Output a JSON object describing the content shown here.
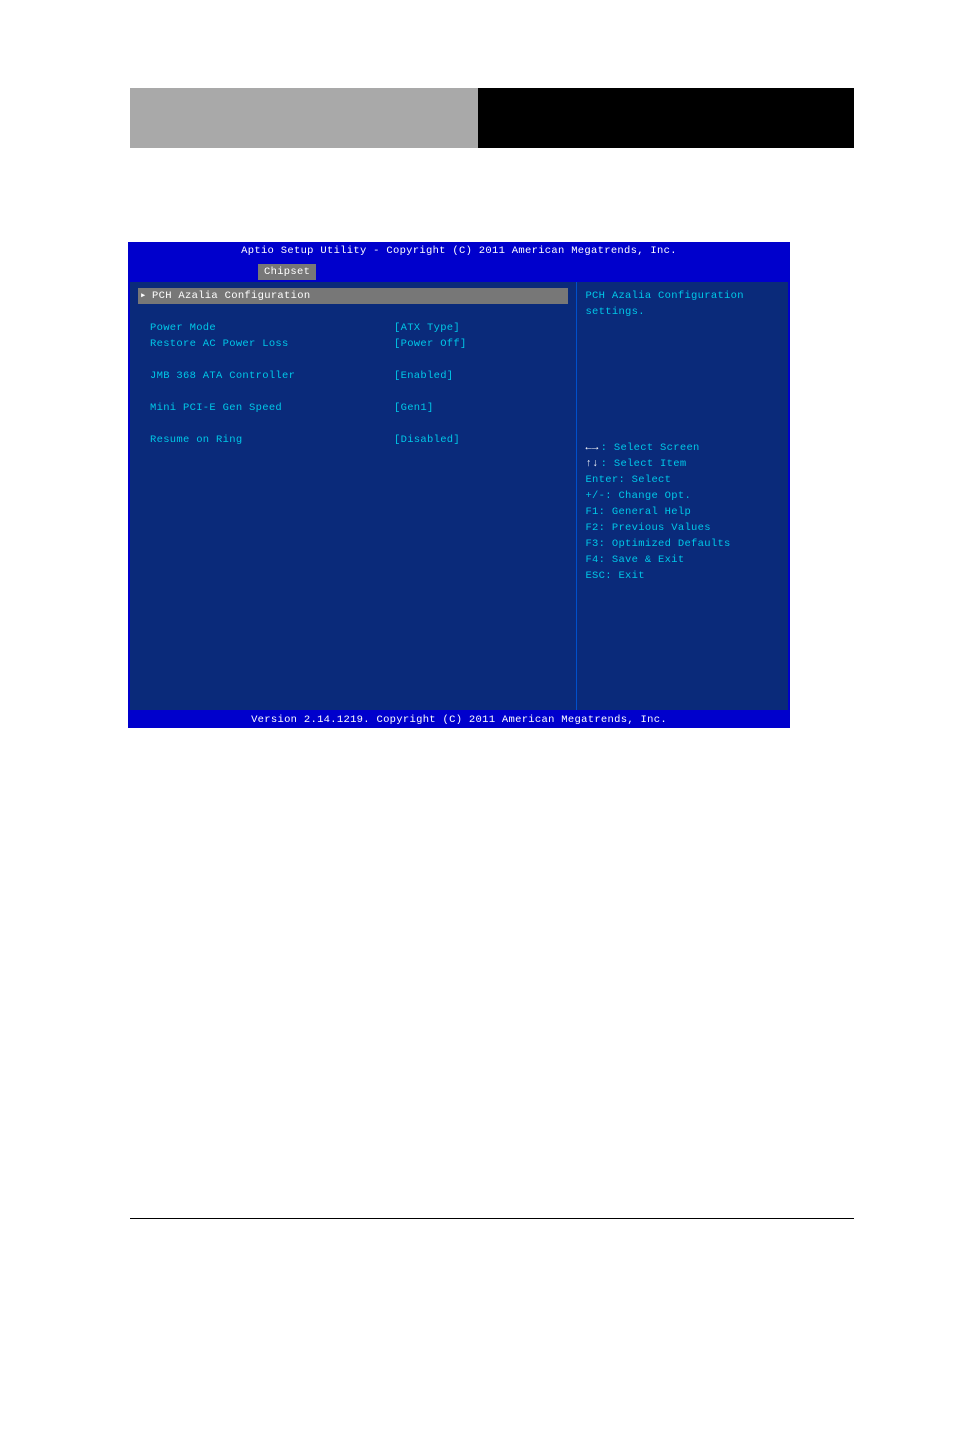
{
  "bios": {
    "title": "Aptio Setup Utility - Copyright (C) 2011 American Megatrends, Inc.",
    "tab": "Chipset",
    "menu": {
      "submenu": "PCH Azalia Configuration",
      "items": [
        {
          "label": "Power Mode",
          "value": "[ATX Type]"
        },
        {
          "label": "Restore AC Power Loss",
          "value": "[Power Off]"
        }
      ],
      "items2": [
        {
          "label": "JMB 368 ATA Controller",
          "value": "[Enabled]"
        }
      ],
      "items3": [
        {
          "label": "Mini PCI-E Gen Speed",
          "value": "[Gen1]"
        }
      ],
      "items4": [
        {
          "label": "Resume on Ring",
          "value": "[Disabled]"
        }
      ]
    },
    "help": {
      "desc1": "PCH Azalia Configuration",
      "desc2": "settings.",
      "keys": {
        "k1": ": Select Screen",
        "k2": ": Select Item",
        "k3": "Enter: Select",
        "k4": "+/-: Change Opt.",
        "k5": "F1: General Help",
        "k6": "F2: Previous Values",
        "k7": "F3: Optimized Defaults",
        "k8": "F4: Save & Exit",
        "k9": "ESC: Exit"
      }
    },
    "footer": "Version 2.14.1219. Copyright (C) 2011 American Megatrends, Inc."
  }
}
